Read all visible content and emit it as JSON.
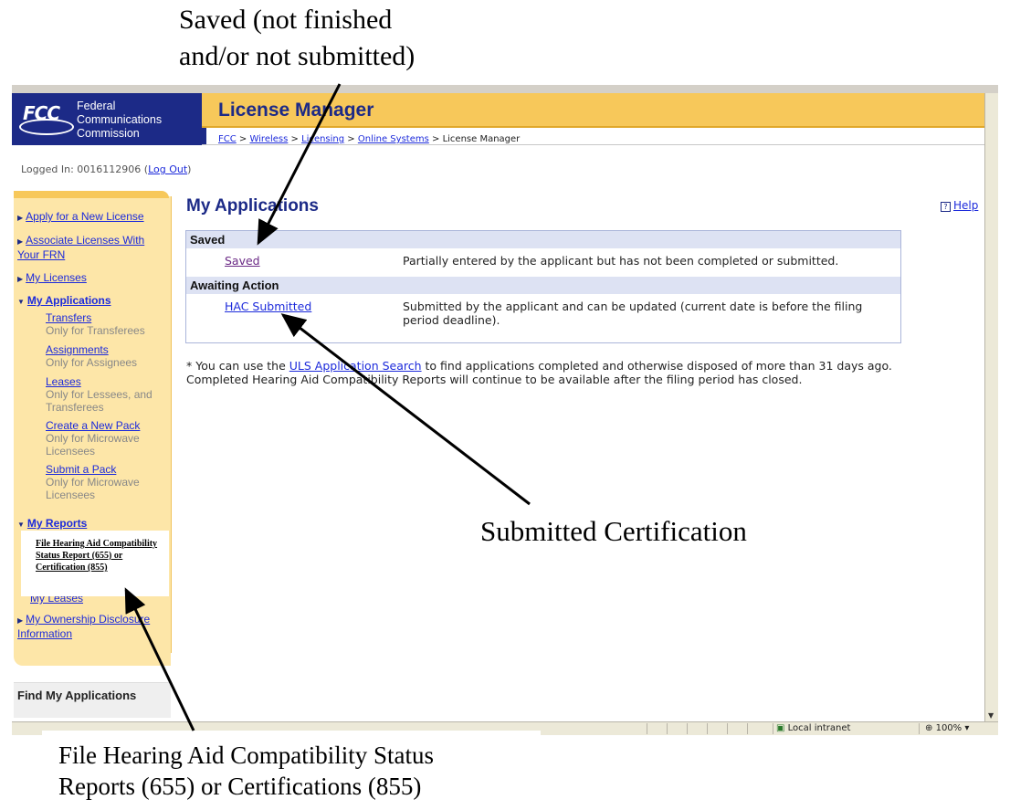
{
  "annotations": {
    "top_line1": "Saved (not finished",
    "top_line2": "and/or not submitted)",
    "middle": "Submitted Certification",
    "bottom_line1": "File Hearing Aid Compatibility Status",
    "bottom_line2": "Reports (655) or Certifications (855)"
  },
  "header": {
    "logo_mark": "FCC",
    "logo_line1": "Federal",
    "logo_line2": "Communications",
    "logo_line3": "Commission",
    "title": "License Manager",
    "breadcrumb": [
      "FCC",
      "Wireless",
      "Licensing",
      "Online Systems",
      "License Manager"
    ],
    "crumb_sep": ">"
  },
  "session": {
    "logged_in_prefix": "Logged In: 0016112906 (",
    "logout": "Log Out",
    "logged_in_suffix": ")"
  },
  "sidebar": {
    "apply": "Apply for a New License",
    "associate": "Associate Licenses With Your FRN",
    "my_licenses": "My Licenses",
    "my_applications": "My Applications",
    "sub_items": [
      {
        "label": "Transfers",
        "note": "Only for Transferees"
      },
      {
        "label": "Assignments",
        "note": "Only for Assignees"
      },
      {
        "label": "Leases",
        "note": "Only for Lessees, and Transferees"
      },
      {
        "label": "Create a New Pack",
        "note": "Only for Microwave Licensees"
      },
      {
        "label": "Submit a Pack",
        "note": "Only for Microwave Licensees"
      }
    ],
    "my_reports": "My Reports",
    "reports_popup": "File Hearing Aid Compatibility Status Report (655) or Certification (855)",
    "my_leases": "My Leases",
    "ownership": "My Ownership Disclosure Information",
    "find": "Find My Applications"
  },
  "main": {
    "title": "My Applications",
    "help": "Help",
    "saved_header": "Saved",
    "saved_link": "Saved",
    "saved_desc": "Partially entered by the applicant but has not been completed or submitted.",
    "awaiting_header": "Awaiting Action",
    "hac_link": "HAC Submitted",
    "hac_desc": "Submitted by the applicant and can be updated (current date is before the filing period deadline).",
    "footnote_prefix": "* You can use the ",
    "footnote_link": "ULS Application Search",
    "footnote_suffix": " to find applications completed and otherwise disposed of more than 31 days ago. Completed Hearing Aid Compatibility Reports will continue to be available after the filing period has closed."
  },
  "statusbar": {
    "zone": "Local intranet",
    "zoom": "100%"
  }
}
